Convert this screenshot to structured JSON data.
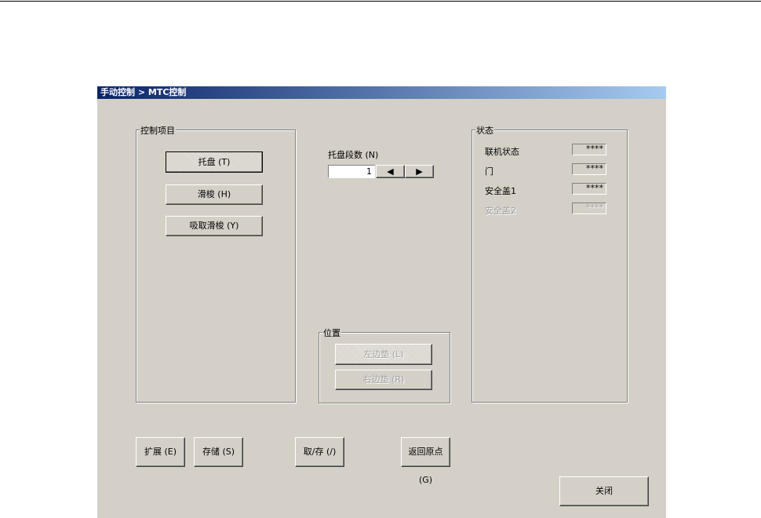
{
  "window": {
    "title": "手动控制 > MTC控制"
  },
  "control_group": {
    "label": "控制项目",
    "buttons": [
      "托盘 (T)",
      "滑梭 (H)",
      "吸取滑梭 (Y)"
    ]
  },
  "pallet": {
    "label": "托盘段数 (N)",
    "value": "1"
  },
  "position_group": {
    "label": "位置",
    "buttons": [
      "左边垫 (L)",
      "右边垫 (R)"
    ]
  },
  "status_group": {
    "label": "状态",
    "items": [
      {
        "label": "联机状态",
        "value": "****"
      },
      {
        "label": "门",
        "value": "****"
      },
      {
        "label": "安全盖1",
        "value": "****"
      },
      {
        "label": "安全盖2",
        "value": "****"
      }
    ]
  },
  "footer": {
    "expand": "扩展 (E)",
    "store": "存储 (S)",
    "fetch_store": "取/存 (/)",
    "home": "返回原点 (G)",
    "close": "关闭"
  }
}
